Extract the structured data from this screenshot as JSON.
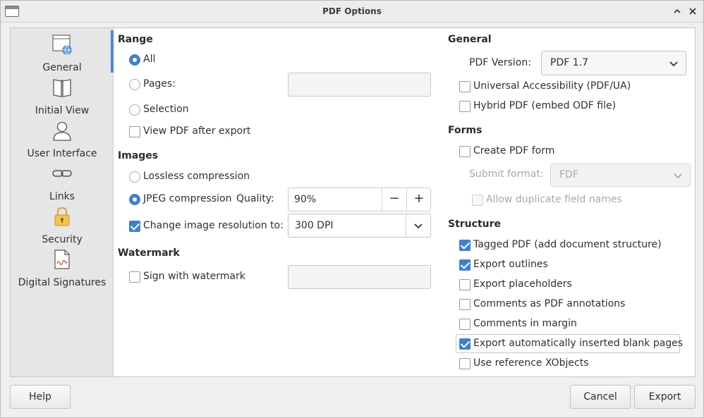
{
  "window": {
    "title": "PDF Options"
  },
  "sidebar": {
    "items": [
      {
        "label": "General",
        "icon": "globe-document-icon"
      },
      {
        "label": "Initial View",
        "icon": "open-book-icon"
      },
      {
        "label": "User Interface",
        "icon": "user-icon"
      },
      {
        "label": "Links",
        "icon": "link-icon"
      },
      {
        "label": "Security",
        "icon": "padlock-icon"
      },
      {
        "label": "Digital Signatures",
        "icon": "signed-document-icon"
      }
    ]
  },
  "range": {
    "title": "Range",
    "all": "All",
    "pages": "Pages:",
    "pages_value": "",
    "selection": "Selection",
    "view_pdf": "View PDF after export"
  },
  "images": {
    "title": "Images",
    "lossless": "Lossless compression",
    "jpeg": "JPEG compression",
    "quality_label": "Quality:",
    "quality_value": "90%",
    "minus": "−",
    "plus": "+",
    "change_res": "Change image resolution to:",
    "resolution": "300 DPI"
  },
  "watermark": {
    "title": "Watermark",
    "sign": "Sign with watermark",
    "value": ""
  },
  "general": {
    "title": "General",
    "pdf_version_label": "PDF Version:",
    "pdf_version": "PDF 1.7",
    "universal": "Universal Accessibility (PDF/UA)",
    "hybrid": "Hybrid PDF (embed ODF file)"
  },
  "forms": {
    "title": "Forms",
    "create": "Create PDF form",
    "submit_label": "Submit format:",
    "submit_value": "FDF",
    "duplicate": "Allow duplicate field names"
  },
  "structure": {
    "title": "Structure",
    "tagged": "Tagged PDF (add document structure)",
    "outlines": "Export outlines",
    "placeholders": "Export placeholders",
    "comments_annot": "Comments as PDF annotations",
    "comments_margin": "Comments in margin",
    "blank_pages": "Export automatically inserted blank pages",
    "xobjects": "Use reference XObjects"
  },
  "footer": {
    "help": "Help",
    "cancel": "Cancel",
    "export": "Export"
  },
  "colors": {
    "accent": "#3d7fd6",
    "sidebar_bg": "#e6e6e6"
  }
}
